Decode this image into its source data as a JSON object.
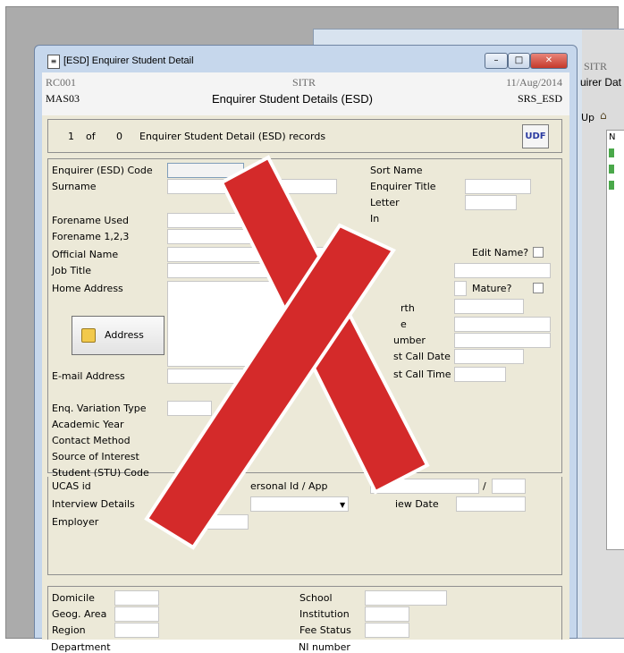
{
  "background_window": {
    "sitr": "SITR",
    "title_fragment": "uirer Dat",
    "toolbar_up": "Up",
    "toolbar_home_fragment": "H",
    "pane_fragment": "N"
  },
  "window": {
    "title": "[ESD] Enquirer Student Detail",
    "controls": {
      "minimize": "–",
      "maximize": "□",
      "close": "✕"
    }
  },
  "header": {
    "code": "RC001",
    "module": "MAS03",
    "system": "SITR",
    "title": "Enquirer Student Details (ESD)",
    "date": "11/Aug/2014",
    "screen": "SRS_ESD"
  },
  "records": {
    "current": "1",
    "of": "of",
    "total": "0",
    "label": "Enquirer Student Detail (ESD) records",
    "udf": "UDF"
  },
  "form": {
    "left": {
      "code": "Enquirer (ESD) Code",
      "surname": "Surname",
      "forename_used": "Forename Used",
      "forename_123": "Forename 1,2,3",
      "official_name": "Official Name",
      "job_title": "Job Title",
      "home_address": "Home Address",
      "address_button": "Address",
      "email": "E-mail Address"
    },
    "right": {
      "sort_name": "Sort Name",
      "enquirer_title": "Enquirer Title",
      "letter": "Letter",
      "in": "In",
      "edit_name": "Edit Name?",
      "mature": "Mature?",
      "rth_fragment": "rth",
      "e_fragment": "e",
      "number_fragment": "umber",
      "last_call_date": "st Call Date",
      "last_call_time": "st Call Time"
    }
  },
  "enquiry": {
    "variation": "Enq. Variation Type",
    "academic_year": "Academic Year",
    "contact": "Contact Method",
    "source": "Source of Interest",
    "student": "Student (STU) Code",
    "ucas": "UCAS id",
    "personal_id": "ersonal Id / App",
    "slash": "/",
    "interview": "Interview Details",
    "interview_date": "iew Date",
    "employer": "Employer"
  },
  "bottom": {
    "left": [
      "Domicile",
      "Geog. Area",
      "Region",
      "Department"
    ],
    "right": [
      "School",
      "Institution",
      "Fee Status",
      "NI number"
    ]
  },
  "colors": {
    "cross": "#d42a2a",
    "window_frame": "#c6d7ec",
    "form_bg": "#ece9d8"
  }
}
